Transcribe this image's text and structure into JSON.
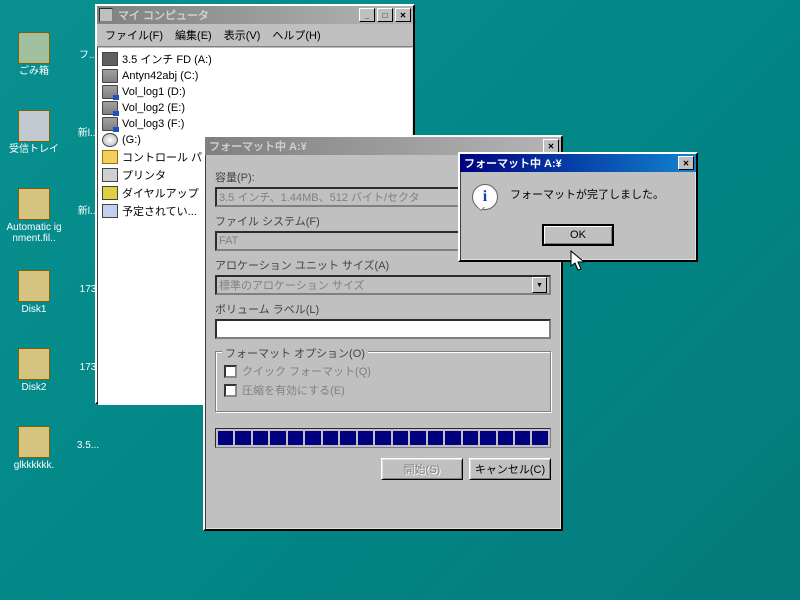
{
  "desktop": {
    "icons": [
      {
        "label": "ごみ箱",
        "kind": "bin"
      },
      {
        "label": "受信トレイ",
        "kind": "inbox"
      },
      {
        "label": "Automatic ignment.fil..",
        "kind": "folder"
      },
      {
        "label": "Disk1",
        "kind": "folder"
      },
      {
        "label": "Disk2",
        "kind": "folder"
      },
      {
        "label": "glkkkkkk.",
        "kind": "folder"
      }
    ],
    "col2": [
      {
        "label": "フ..."
      },
      {
        "label": "新l..."
      },
      {
        "label": "新l..."
      },
      {
        "label": "173"
      },
      {
        "label": "173"
      },
      {
        "label": "3.5..."
      }
    ]
  },
  "mycomputer": {
    "title": "マイ コンピュータ",
    "menu": {
      "file": "ファイル(F)",
      "edit": "編集(E)",
      "view": "表示(V)",
      "help": "ヘルプ(H)"
    },
    "drives": [
      {
        "label": "3.5 インチ FD (A:)",
        "icon": "floppy"
      },
      {
        "label": "Antyn42abj (C:)",
        "icon": "hdd"
      },
      {
        "label": "Vol_log1 (D:)",
        "icon": "net"
      },
      {
        "label": "Vol_log2 (E:)",
        "icon": "net"
      },
      {
        "label": "Vol_log3 (F:)",
        "icon": "net"
      },
      {
        "label": "(G:)",
        "icon": "cd"
      },
      {
        "label": "コントロール パネル",
        "icon": "folder"
      },
      {
        "label": "プリンタ",
        "icon": "printer"
      },
      {
        "label": "ダイヤルアップ ネ...",
        "icon": "dialup"
      },
      {
        "label": "予定されてい...",
        "icon": "sched"
      }
    ]
  },
  "format": {
    "title": "フォーマット中 A:¥",
    "capacity_label": "容量(P):",
    "capacity_value": "3.5 インチ、1.44MB、512 バイト/セクタ",
    "filesystem_label": "ファイル システム(F)",
    "filesystem_value": "FAT",
    "alloc_label": "アロケーション ユニット サイズ(A)",
    "alloc_value": "標準のアロケーション サイズ",
    "volume_label_lbl": "ボリューム ラベル(L)",
    "volume_label_value": "",
    "options_legend": "フォーマット オプション(O)",
    "quick_label": "クイック フォーマット(Q)",
    "compress_label": "圧縮を有効にする(E)",
    "start_btn": "開始(S)",
    "cancel_btn": "キャンセル(C)",
    "progress_segments": 19
  },
  "msgbox": {
    "title": "フォーマット中 A:¥",
    "text": "フォーマットが完了しました。",
    "ok": "OK"
  }
}
